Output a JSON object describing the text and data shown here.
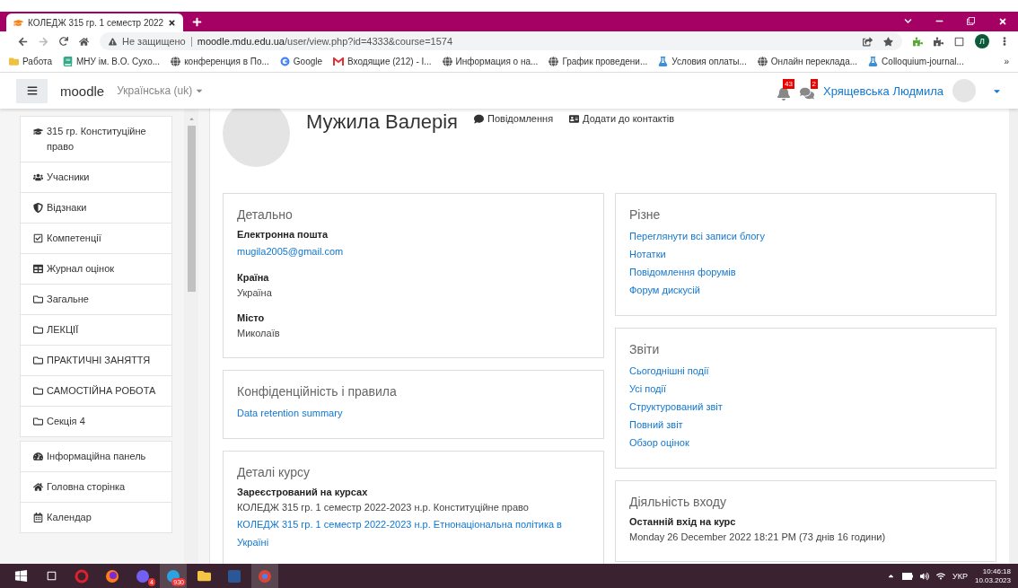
{
  "browser": {
    "tab_title": "КОЛЕДЖ 315 гр. 1 семестр 2022",
    "security": "Не защищено",
    "url_domain": "moodle.mdu.edu.ua",
    "url_path": "/user/view.php?id=4333&course=1574",
    "profile_initial": "Л",
    "bookmarks": [
      {
        "label": "Работа"
      },
      {
        "label": "МНУ ім. В.О. Сухо..."
      },
      {
        "label": "конференция в По..."
      },
      {
        "label": "Google"
      },
      {
        "label": "Входящие (212) - I..."
      },
      {
        "label": "Информация о на..."
      },
      {
        "label": "График проведени..."
      },
      {
        "label": "Условия оплаты..."
      },
      {
        "label": "Онлайн переклада..."
      },
      {
        "label": "Colloquium-journal..."
      }
    ],
    "bookmarks_more": "»"
  },
  "navbar": {
    "logo": "moodle",
    "language": "Українська (uk)",
    "notifications_count": "43",
    "messages_count": "2",
    "user_name": "Хрящевська Людмила"
  },
  "sidebar": {
    "groups": [
      {
        "items": [
          {
            "label": "315 гр. Конституційне право"
          },
          {
            "label": "Учасники"
          },
          {
            "label": "Відзнаки"
          },
          {
            "label": "Компетенції"
          },
          {
            "label": "Журнал оцінок"
          },
          {
            "label": "Загальне"
          },
          {
            "label": "ЛЕКЦІЇ"
          },
          {
            "label": "ПРАКТИЧНІ ЗАНЯТТЯ"
          },
          {
            "label": "САМОСТІЙНА РОБОТА"
          },
          {
            "label": "Секція 4"
          }
        ]
      },
      {
        "items": [
          {
            "label": "Інформаційна панель"
          },
          {
            "label": "Головна сторінка"
          },
          {
            "label": "Календар"
          }
        ]
      }
    ]
  },
  "profile": {
    "name": "Мужила Валерія",
    "actions": [
      "Повідомлення",
      "Додати до контактів"
    ]
  },
  "columns": [
    [
      {
        "title": "Детально",
        "entries": [
          {
            "kind": "heading",
            "text": "Електронна пошта"
          },
          {
            "kind": "link",
            "text": "mugila2005@gmail.com"
          },
          {
            "kind": "heading",
            "text": "Країна"
          },
          {
            "kind": "text",
            "text": "Україна"
          },
          {
            "kind": "heading",
            "text": "Місто"
          },
          {
            "kind": "text",
            "text": "Миколаїв"
          }
        ]
      },
      {
        "title": "Конфіденційність і правила",
        "entries": [
          {
            "kind": "link",
            "text": "Data retention summary"
          }
        ]
      },
      {
        "title": "Деталі курсу",
        "entries": [
          {
            "kind": "heading",
            "text": "Зареєстрований на курсах"
          },
          {
            "kind": "text",
            "text": "КОЛЕДЖ 315 гр. 1 семестр 2022-2023 н.р. Конституційне право"
          },
          {
            "kind": "link",
            "text": "КОЛЕДЖ 315 гр. 1 семестр 2022-2023 н.р. Етнонаціональна політика в Україні"
          }
        ]
      }
    ],
    [
      {
        "title": "Різне",
        "entries": [
          {
            "kind": "link",
            "text": "Переглянути всі записи блогу"
          },
          {
            "kind": "link",
            "text": "Нотатки"
          },
          {
            "kind": "link",
            "text": "Повідомлення форумів"
          },
          {
            "kind": "link",
            "text": "Форум дискусій"
          }
        ]
      },
      {
        "title": "Звіти",
        "entries": [
          {
            "kind": "link",
            "text": "Сьогоднішні події"
          },
          {
            "kind": "link",
            "text": "Усі події"
          },
          {
            "kind": "link",
            "text": "Структурований звіт"
          },
          {
            "kind": "link",
            "text": "Повний звіт"
          },
          {
            "kind": "link",
            "text": "Обзор оцінок"
          }
        ]
      },
      {
        "title": "Діяльність входу",
        "entries": [
          {
            "kind": "heading",
            "text": "Останній вхід на курс"
          },
          {
            "kind": "text",
            "text": "Monday 26 December 2022 18:21 PM  (73 днів 16 години)"
          }
        ]
      }
    ]
  ],
  "taskbar": {
    "apps": [
      {
        "badge": "4"
      },
      {
        "badge": "930"
      }
    ],
    "language": "УКР",
    "time": "10:46:18",
    "date": "10.03.2023"
  }
}
